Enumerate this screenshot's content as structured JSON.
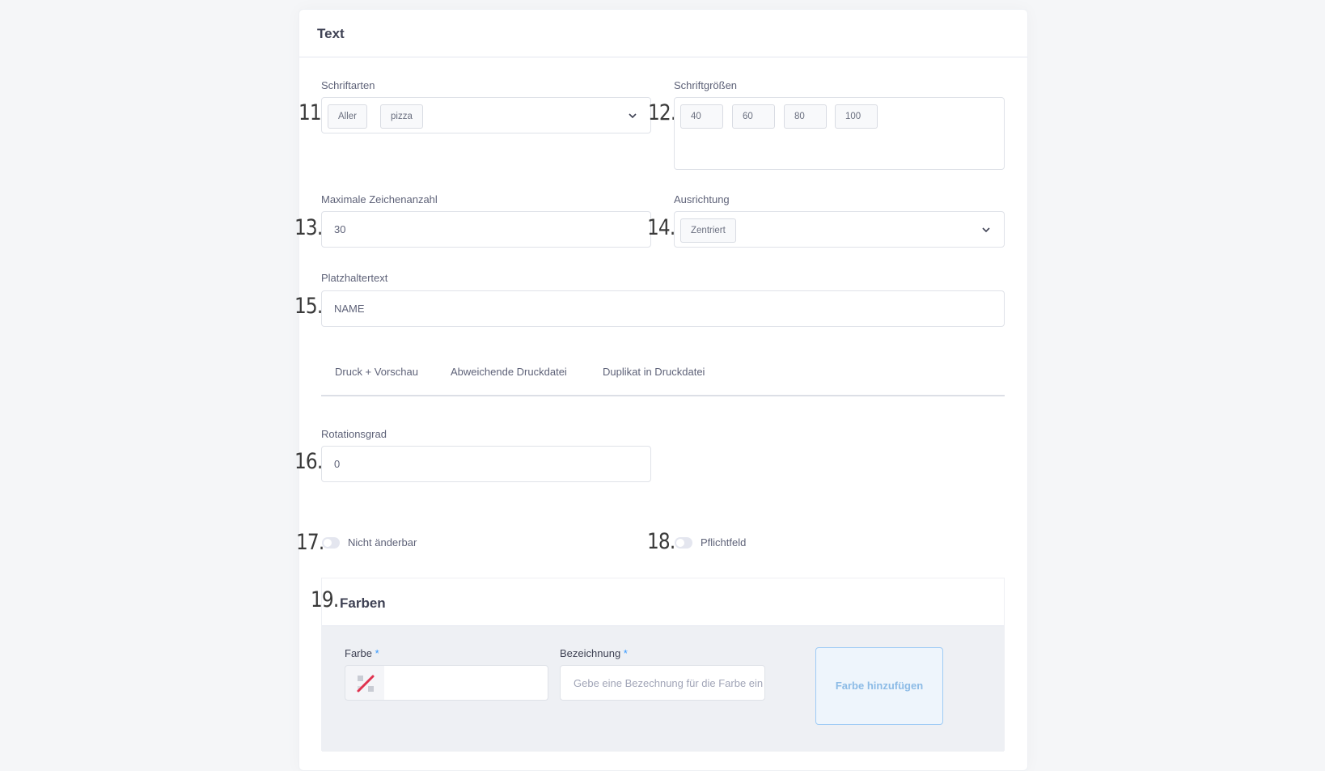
{
  "section": {
    "title": "Text"
  },
  "fields": {
    "schriftarten": {
      "number": "11.",
      "label": "Schriftarten",
      "chips": [
        "Aller",
        "pizza"
      ]
    },
    "schriftgroessen": {
      "number": "12.",
      "label": "Schriftgrößen",
      "chips": [
        "40",
        "60",
        "80",
        "100"
      ]
    },
    "max_zeichen": {
      "number": "13.",
      "label": "Maximale Zeichenanzahl",
      "value": "30"
    },
    "ausrichtung": {
      "number": "14.",
      "label": "Ausrichtung",
      "chips": [
        "Zentriert"
      ]
    },
    "platzhalter": {
      "number": "15.",
      "label": "Platzhaltertext",
      "value": "NAME"
    },
    "rotation": {
      "number": "16.",
      "label": "Rotationsgrad",
      "value": "0"
    }
  },
  "tabs": [
    "Druck + Vorschau",
    "Abweichende Druckdatei",
    "Duplikat in Druckdatei"
  ],
  "toggles": {
    "nicht_aenderbar": {
      "number": "17.",
      "label": "Nicht änderbar",
      "on": false
    },
    "pflichtfeld": {
      "number": "18.",
      "label": "Pflichtfeld",
      "on": false
    }
  },
  "farben": {
    "number": "19.",
    "title": "Farben",
    "farbe_label": "Farbe",
    "bezeichnung_label": "Bezeichnung",
    "required_mark": "*",
    "bezeichnung_placeholder": "Gebe eine Bezechnung für die Farbe ein",
    "add_button": "Farbe hinzufügen"
  },
  "colors": {
    "accent": "#3699ff",
    "no_color_icon": "#e0334f"
  }
}
